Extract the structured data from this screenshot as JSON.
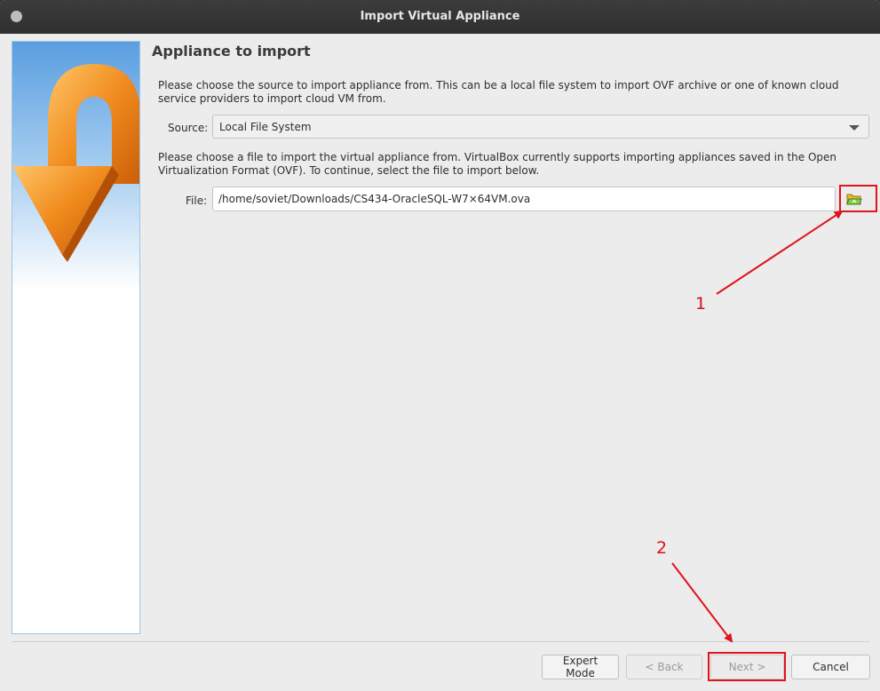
{
  "window": {
    "title": "Import Virtual Appliance"
  },
  "page": {
    "title": "Appliance to import",
    "description_source": "Please choose the source to import appliance from. This can be a local file system to import OVF archive or one of known cloud service providers to import cloud VM from.",
    "source_label": "Source:",
    "source_value": "Local File System",
    "description_file": "Please choose a file to import the virtual appliance from. VirtualBox currently supports importing appliances saved in the Open Virtualization Format (OVF). To continue, select the file to import below.",
    "file_label": "File:",
    "file_value": "/home/soviet/Downloads/CS434-OracleSQL-W7×64VM.ova"
  },
  "buttons": {
    "expert_mode": "Expert Mode",
    "back": "< Back",
    "next": "Next >",
    "cancel": "Cancel"
  },
  "annotations": {
    "step1": "1",
    "step2": "2"
  },
  "colors": {
    "annotation": "#e0141c",
    "accent_orange": "#f08a1c",
    "side_border": "#9cc6e8"
  },
  "icons": {
    "folder": "folder-open-icon",
    "import_art": "import-arrow-icon"
  }
}
